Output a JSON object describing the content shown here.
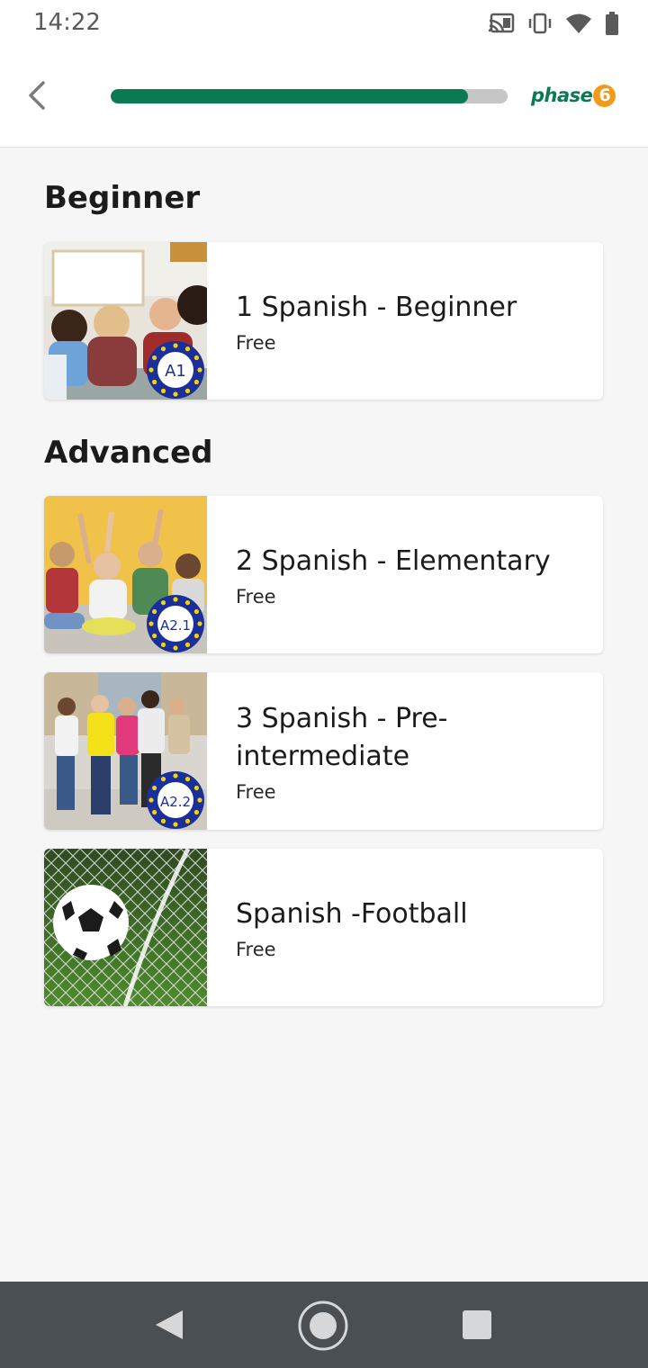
{
  "status_bar": {
    "time": "14:22",
    "icons": [
      "cast-icon",
      "vibrate-icon",
      "wifi-icon",
      "battery-icon"
    ]
  },
  "header": {
    "progress_fraction": 0.9,
    "logo_text": "phase",
    "logo_number": "6",
    "colors": {
      "brand_green": "#0b7a52",
      "brand_orange": "#f39a1d"
    }
  },
  "sections": {
    "beginner": {
      "title": "Beginner",
      "courses": [
        {
          "title": "1 Spanish - Beginner",
          "price": "Free",
          "level": "A1"
        }
      ]
    },
    "advanced": {
      "title": "Advanced",
      "courses": [
        {
          "title": "2 Spanish - Elementary",
          "price": "Free",
          "level": "A2.1"
        },
        {
          "title": "3 Spanish - Pre-intermediate",
          "price": "Free",
          "level": "A2.2"
        },
        {
          "title": "Spanish -Football",
          "price": "Free",
          "level": ""
        }
      ]
    }
  },
  "nav_bar": {
    "buttons": [
      "back",
      "home",
      "recents"
    ]
  }
}
